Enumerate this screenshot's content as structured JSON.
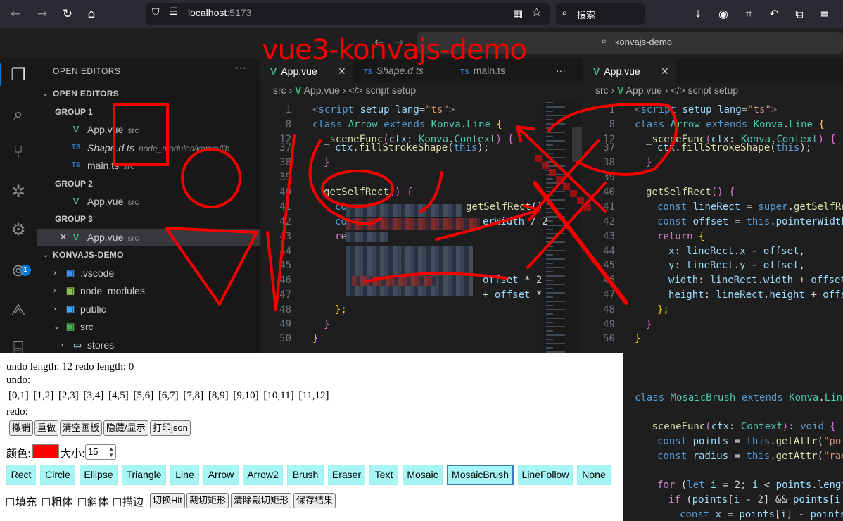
{
  "browser": {
    "url_host": "localhost",
    "url_port": ":5173",
    "search_placeholder": "搜索"
  },
  "vscode": {
    "command_center": "konvajs-demo",
    "explorer_header": "OPEN EDITORS",
    "open_editors_section": "OPEN EDITORS",
    "groups": [
      {
        "label": "GROUP 1",
        "files": [
          {
            "name": "App.vue",
            "dir": "src",
            "type": "vue"
          },
          {
            "name": "Shape.d.ts",
            "dir": "node_modules/konva/lib",
            "type": "ts"
          },
          {
            "name": "main.ts",
            "dir": "src",
            "type": "ts"
          }
        ]
      },
      {
        "label": "GROUP 2",
        "files": [
          {
            "name": "App.vue",
            "dir": "src",
            "type": "vue"
          }
        ]
      },
      {
        "label": "GROUP 3",
        "files": [
          {
            "name": "App.vue",
            "dir": "src",
            "type": "vue"
          }
        ]
      }
    ],
    "project_section": "KONVAJS-DEMO",
    "tree": [
      {
        "name": ".vscode",
        "icon": "vscode-folder-icon"
      },
      {
        "name": "node_modules",
        "icon": "node-folder-icon"
      },
      {
        "name": "public",
        "icon": "public-folder-icon"
      },
      {
        "name": "src",
        "icon": "src-folder-icon"
      },
      {
        "name": "stores",
        "icon": "folder-icon"
      }
    ],
    "left_tabs": [
      "App.vue",
      "Shape.d.ts",
      "main.ts"
    ],
    "right_tabs": [
      "App.vue"
    ],
    "breadcrumb": {
      "folder": "src",
      "file": "App.vue",
      "section": "script setup"
    },
    "activity_badge": "1",
    "more_label": "···"
  },
  "left_code": {
    "line_numbers": [
      "1",
      "8",
      "12",
      "37",
      "38",
      "39",
      "40",
      "41",
      "42",
      "43",
      "44",
      "45",
      "46",
      "47",
      "48",
      "49",
      "50"
    ]
  },
  "right_code": {
    "line_numbers": [
      "1",
      "8",
      "12",
      "37",
      "38",
      "39",
      "40",
      "41",
      "42",
      "43",
      "44",
      "45",
      "46",
      "47",
      "48",
      "49",
      "50"
    ]
  },
  "annotation": {
    "title": "vue3-konvajs-demo",
    "stroke_color": "#f40000"
  },
  "panel": {
    "lengths": "undo length: 12 redo length: 0",
    "undo_label": "undo:",
    "undo_items": "[0,1] [1,2] [2,3] [3,4] [4,5] [5,6] [6,7] [7,8] [8,9] [9,10] [10,11] [11,12]",
    "redo_label": "redo:",
    "actions": [
      "撤销",
      "重做",
      "清空画板",
      "隐藏/显示",
      "打印json"
    ],
    "color_label": "颜色:",
    "color_value": "#ff0000",
    "size_label": "大小:",
    "size_value": "15",
    "tools": [
      "Rect",
      "Circle",
      "Ellipse",
      "Triangle",
      "Line",
      "Arrow",
      "Arrow2",
      "Brush",
      "Eraser",
      "Text",
      "Mosaic",
      "MosaicBrush",
      "LineFollow",
      "None"
    ],
    "active_tool": "MosaicBrush",
    "checkboxes": [
      "填充",
      "粗体",
      "斜体",
      "描边"
    ],
    "bottom_buttons": [
      "切换Hit",
      "裁切矩形",
      "清除裁切矩形",
      "保存结果"
    ]
  }
}
